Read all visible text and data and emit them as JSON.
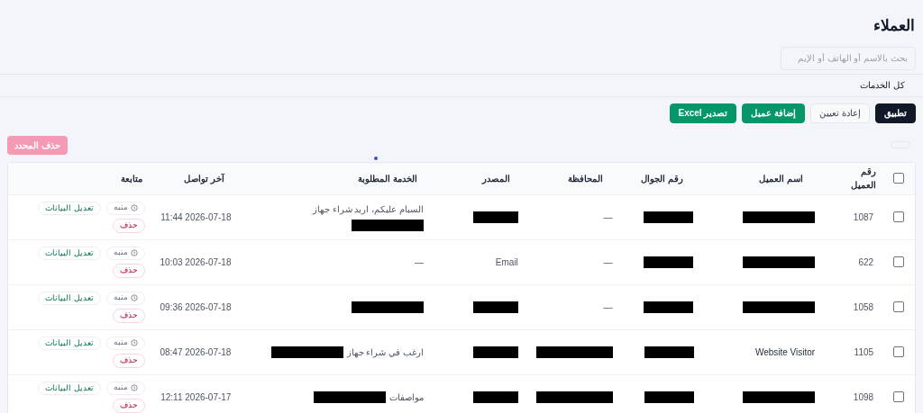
{
  "page_title": "العملاء",
  "search": {
    "placeholder": "بحث بالاسم أو الهاتف أو الإيم"
  },
  "service_filter": {
    "value": "كل الخدمات"
  },
  "actions": [
    {
      "label": "تطبيق",
      "kind": "dark"
    },
    {
      "label": "إعادة تعيين",
      "kind": "plain"
    },
    {
      "label": "إضافة عميل",
      "kind": "green"
    },
    {
      "label": "تصدير Excel",
      "kind": "green"
    }
  ],
  "bulk_delete": {
    "label": "حذف المحدد",
    "disabled": true
  },
  "table": {
    "select_all": {
      "checked": false
    },
    "columns": [
      "رقم العميل",
      "اسم العميل",
      "رقم الجوال",
      "المحافظة",
      "المصدر",
      "الخدمة المطلوبة",
      "آخر تواصل",
      "متابعة"
    ],
    "rows": [
      {
        "checked": false,
        "id": "1087",
        "name": {
          "redacted": true
        },
        "phone": {
          "redacted": true
        },
        "governorate": {
          "text": "—",
          "redacted": false
        },
        "source": {
          "redacted": true
        },
        "service": {
          "text": "السبام عليكم، اريد شراء جهاز",
          "redacted": true
        },
        "last_contact": "2026-07-18 11:44",
        "status": "منبه",
        "edit": "تعديل البيانات",
        "delete": "حذف"
      },
      {
        "checked": false,
        "id": "622",
        "name": {
          "redacted": true
        },
        "phone": {
          "redacted": true
        },
        "governorate": {
          "text": "—",
          "redacted": false
        },
        "source": {
          "text": "Email",
          "redacted": false
        },
        "service": {
          "text": "—",
          "redacted": false
        },
        "last_contact": "2026-07-18 10:03",
        "status": "منبه",
        "edit": "تعديل البيانات",
        "delete": "حذف"
      },
      {
        "checked": false,
        "id": "1058",
        "name": {
          "redacted": true
        },
        "phone": {
          "redacted": true
        },
        "governorate": {
          "text": "—",
          "redacted": false
        },
        "source": {
          "redacted": true
        },
        "service": {
          "redacted": true
        },
        "last_contact": "2026-07-18 09:36",
        "status": "منبه",
        "edit": "تعديل البيانات",
        "delete": "حذف"
      },
      {
        "checked": false,
        "id": "1105",
        "name": {
          "text": "Website Visitor",
          "redacted": false
        },
        "phone": {
          "redacted": true
        },
        "governorate": {
          "redacted": true
        },
        "source": {
          "redacted": true
        },
        "service": {
          "text": "ارغب في شراء جهاز",
          "redacted": true
        },
        "last_contact": "2026-07-18 08:47",
        "status": "منبه",
        "edit": "تعديل البيانات",
        "delete": "حذف"
      },
      {
        "checked": false,
        "id": "1098",
        "name": {
          "redacted": true
        },
        "phone": {
          "redacted": true
        },
        "governorate": {
          "redacted": true
        },
        "source": {
          "redacted": true
        },
        "service": {
          "text": "مواصفات",
          "redacted": true
        },
        "last_contact": "2026-07-17 12:11",
        "status": "منبه",
        "edit": "تعديل البيانات",
        "delete": "حذف"
      }
    ]
  }
}
